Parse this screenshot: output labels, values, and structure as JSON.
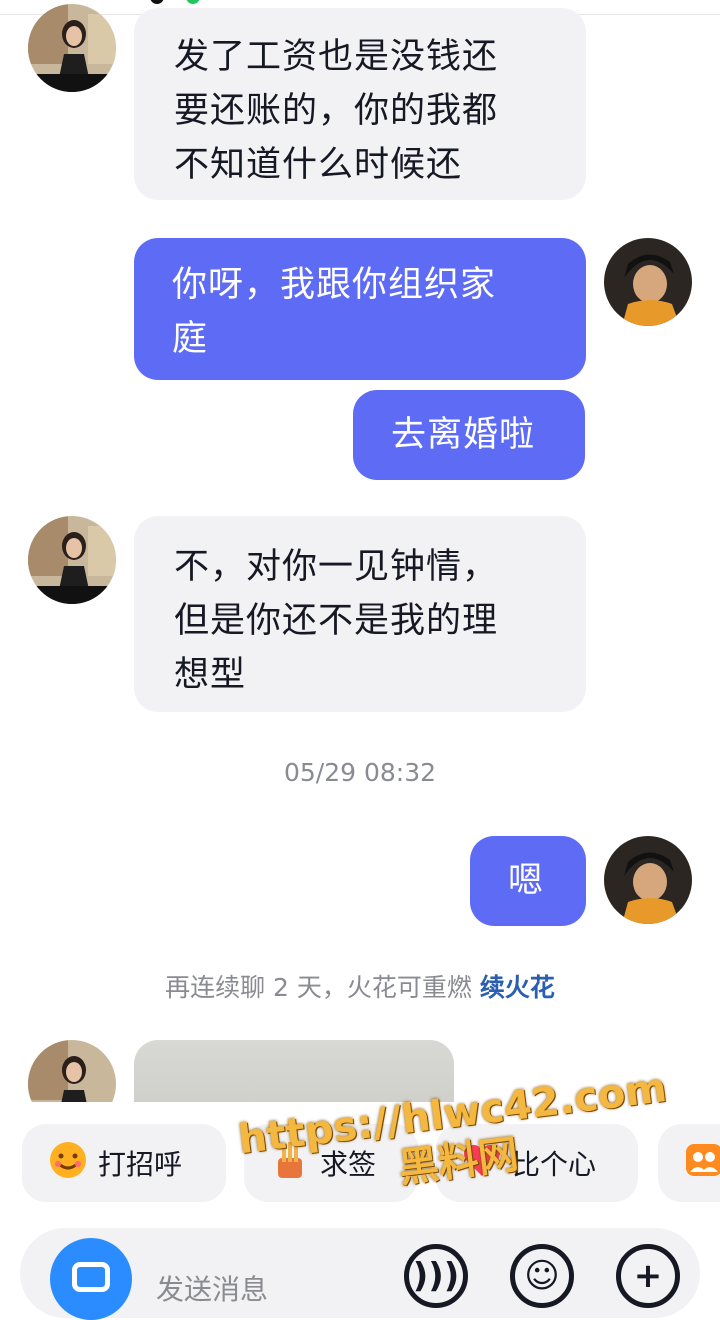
{
  "messages": [
    {
      "side": "in",
      "text": "发了工资也是没钱还\n要还账的，你的我都\n不知道什么时候还"
    },
    {
      "side": "out",
      "text": "你呀，我跟你组织家\n庭"
    },
    {
      "side": "out",
      "text": "去离婚啦"
    },
    {
      "side": "in",
      "text": "不，对你一见钟情，\n但是你还不是我的理\n想型"
    },
    {
      "side": "out",
      "text": "嗯"
    }
  ],
  "timestamp": "05/29 08:32",
  "streak": {
    "text": "再连续聊 2 天，火花可重燃",
    "action": "续火花"
  },
  "quick_actions": [
    {
      "label": "打招呼",
      "icon": "smile-emoji-icon"
    },
    {
      "label": "求签",
      "icon": "fortune-stick-icon"
    },
    {
      "label": "比个心",
      "icon": "heart-icon"
    },
    {
      "label": "",
      "icon": "group-photo-icon"
    }
  ],
  "composer": {
    "placeholder": "发送消息",
    "left_icon": "camera-icon",
    "right_icons": [
      "voice-icon",
      "emoji-icon",
      "plus-icon"
    ]
  },
  "watermark": {
    "line1": "https://hlwc42.com",
    "line2": "黑料网"
  },
  "colors": {
    "outgoing_bubble": "#5e6cf5",
    "incoming_bubble": "#f2f2f4",
    "link": "#2a5faf"
  }
}
